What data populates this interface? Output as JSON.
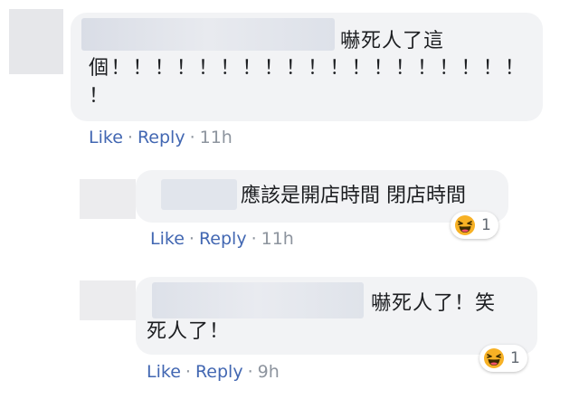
{
  "comments": [
    {
      "text_line1": "嚇死人了這",
      "text_line2": "個！！！！！！！！！！！！！！！！！！！",
      "text_line3": "！",
      "like_label": "Like",
      "reply_label": "Reply",
      "time": "11h"
    },
    {
      "text_line1": "應該是開店時間 閉店時間",
      "reaction_icon": "laughing-emoji-icon",
      "reaction_count": "1",
      "like_label": "Like",
      "reply_label": "Reply",
      "time": "11h"
    },
    {
      "text_line1": "嚇死人了！笑",
      "text_line2": "死人了！",
      "reaction_icon": "laughing-emoji-icon",
      "reaction_count": "1",
      "like_label": "Like",
      "reply_label": "Reply",
      "time": "9h"
    }
  ],
  "colors": {
    "bubble": "#f2f3f5",
    "link": "#4267b2",
    "meta": "#8d949e",
    "reaction_face": "#f7b125"
  }
}
